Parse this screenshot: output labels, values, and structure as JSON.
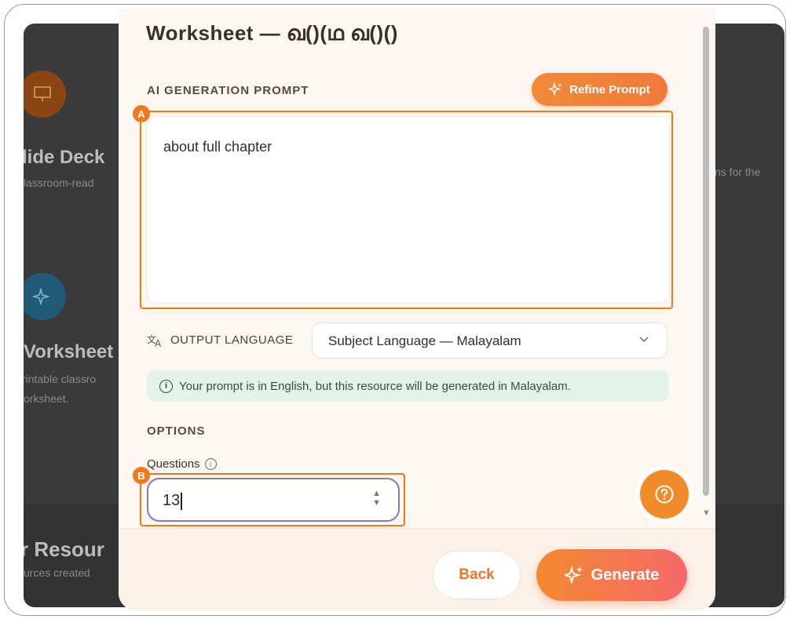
{
  "background": {
    "cards": [
      {
        "title": "lide Deck",
        "subtitle": "lassroom-read"
      },
      {
        "title": "Vorksheet",
        "subtitle": "rintable classro",
        "subtitle2": "orksheet."
      }
    ],
    "right_snippet": "ns for the",
    "resources_title": "r Resour",
    "resources_sub": "urces created"
  },
  "modal": {
    "title": "Worksheet — ഖ()(ഥ ഖ()()",
    "prompt_section_label": "AI GENERATION PROMPT",
    "refine_label": "Refine Prompt",
    "prompt_value": "about full chapter",
    "language_label": "OUTPUT LANGUAGE",
    "language_value": "Subject Language — Malayalam",
    "info_text": "Your prompt is in English, but this resource will be generated in Malayalam.",
    "options_label": "OPTIONS",
    "questions_label": "Questions",
    "questions_value": "13"
  },
  "footer": {
    "back_label": "Back",
    "generate_label": "Generate"
  },
  "annotations": {
    "a": "A",
    "b": "B"
  },
  "colors": {
    "accent": "#f07a1a",
    "focus_ring": "#7d77d6",
    "info_bg": "#e4f2ec"
  }
}
